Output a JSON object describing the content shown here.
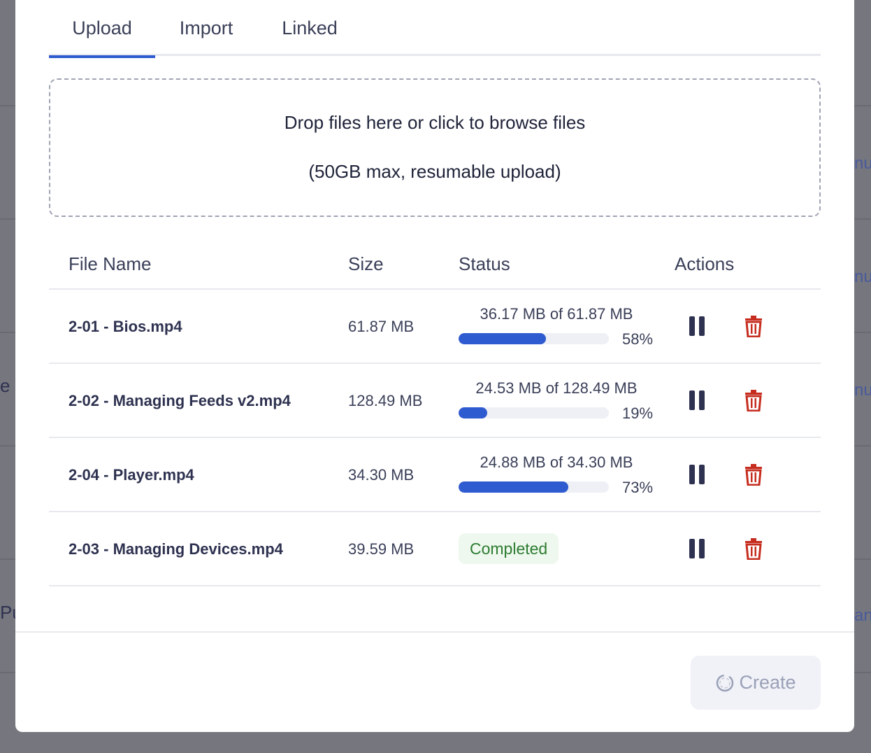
{
  "tabs": [
    {
      "label": "Upload",
      "active": true
    },
    {
      "label": "Import",
      "active": false
    },
    {
      "label": "Linked",
      "active": false
    }
  ],
  "dropzone": {
    "title": "Drop files here or click to browse files",
    "subtitle": "(50GB max, resumable upload)"
  },
  "table": {
    "headers": {
      "name": "File Name",
      "size": "Size",
      "status": "Status",
      "actions": "Actions"
    },
    "rows": [
      {
        "name": "2-01 - Bios.mp4",
        "size": "61.87 MB",
        "progress_text": "36.17 MB of 61.87 MB",
        "percent_label": "58%",
        "percent": 58,
        "status": "uploading"
      },
      {
        "name": "2-02 - Managing Feeds v2.mp4",
        "size": "128.49 MB",
        "progress_text": "24.53 MB of 128.49 MB",
        "percent_label": "19%",
        "percent": 19,
        "status": "uploading"
      },
      {
        "name": "2-04 - Player.mp4",
        "size": "34.30 MB",
        "progress_text": "24.88 MB of 34.30 MB",
        "percent_label": "73%",
        "percent": 73,
        "status": "uploading"
      },
      {
        "name": "2-03 - Managing Devices.mp4",
        "size": "39.59 MB",
        "status": "completed",
        "status_label": "Completed"
      }
    ]
  },
  "actions": {
    "pause_icon": "pause-icon",
    "delete_icon": "trash-icon"
  },
  "footer": {
    "create_label": "Create"
  },
  "background": {
    "left_texts": [
      "e",
      "Pu"
    ],
    "right_texts": [
      "nu",
      "nu",
      "nu",
      "anc"
    ]
  },
  "colors": {
    "accent": "#2f5bd0",
    "danger": "#c62d1f",
    "success": "#2e7d32",
    "success_bg": "#eef8ee"
  }
}
